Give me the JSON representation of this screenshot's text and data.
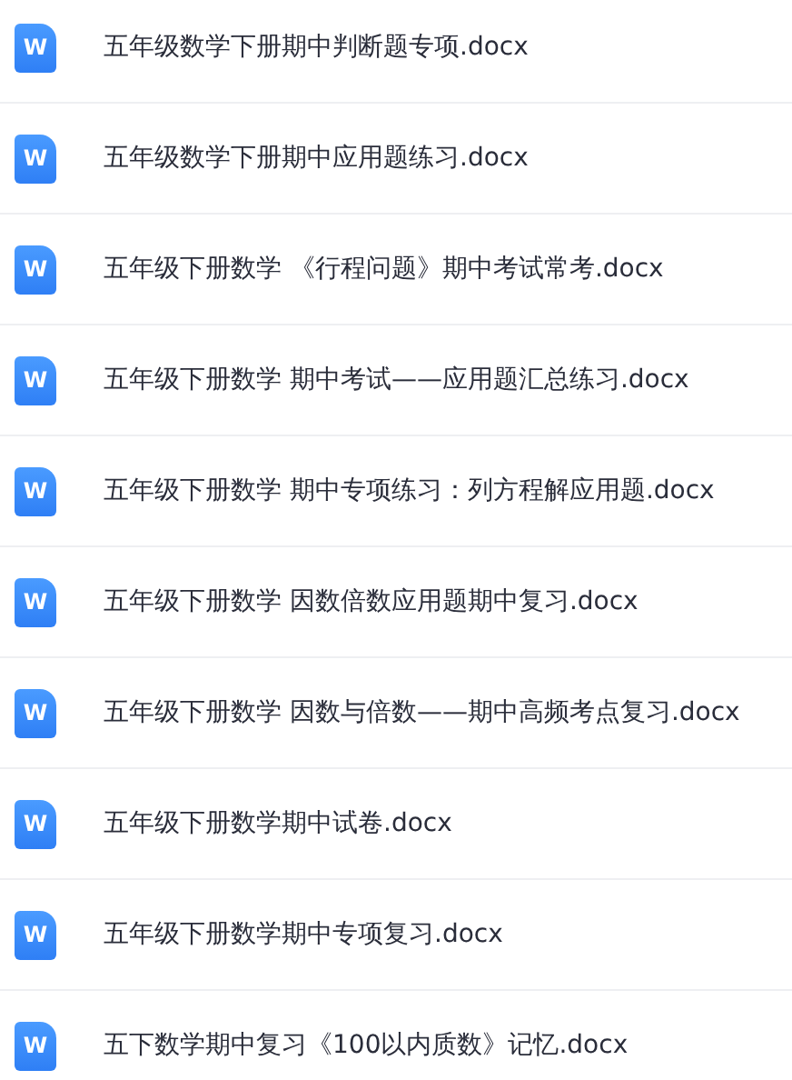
{
  "files": [
    {
      "icon_label": "W",
      "name": "五年级数学下册期中判断题专项.docx"
    },
    {
      "icon_label": "W",
      "name": "五年级数学下册期中应用题练习.docx"
    },
    {
      "icon_label": "W",
      "name": "五年级下册数学 《行程问题》期中考试常考.docx"
    },
    {
      "icon_label": "W",
      "name": "五年级下册数学 期中考试——应用题汇总练习.docx"
    },
    {
      "icon_label": "W",
      "name": "五年级下册数学 期中专项练习：列方程解应用题.docx"
    },
    {
      "icon_label": "W",
      "name": "五年级下册数学 因数倍数应用题期中复习.docx"
    },
    {
      "icon_label": "W",
      "name": "五年级下册数学 因数与倍数——期中高频考点复习.docx"
    },
    {
      "icon_label": "W",
      "name": "五年级下册数学期中试卷.docx"
    },
    {
      "icon_label": "W",
      "name": "五年级下册数学期中专项复习.docx"
    },
    {
      "icon_label": "W",
      "name": "五下数学期中复习《100以内质数》记忆.docx"
    }
  ]
}
